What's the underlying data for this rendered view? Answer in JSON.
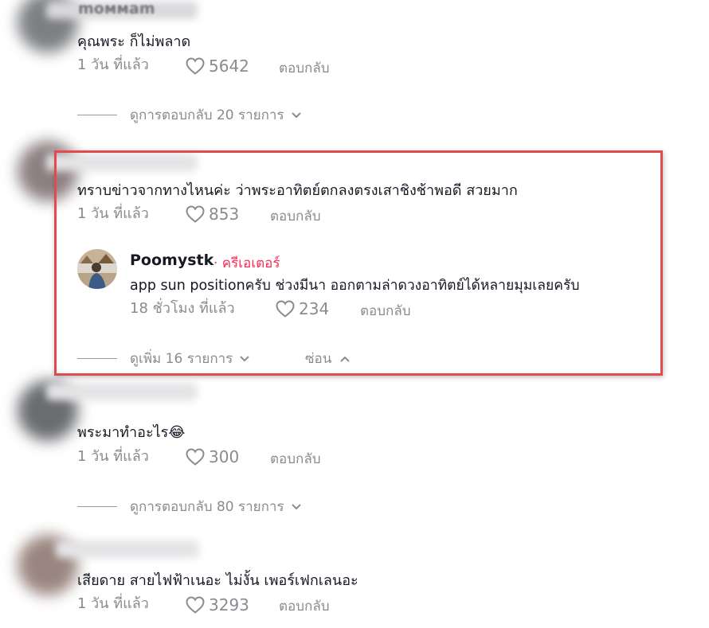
{
  "comments": [
    {
      "text": "คุณพระ ก็ไม่พลาด",
      "time": "1 วัน ที่แล้ว",
      "likes": "5642",
      "reply_label": "ตอบกลับ",
      "view_replies": "ดูการตอบกลับ 20 รายการ",
      "username_partial": "moммam"
    },
    {
      "text": "ทราบข่าวจากทางไหนค่ะ ว่าพระอาทิตย์ตกลงตรงเสาชิงช้าพอดี สวยมาก",
      "time": "1 วัน ที่แล้ว",
      "likes": "853",
      "reply_label": "ตอบกลับ",
      "reply": {
        "username": "Poomystk",
        "tag": "· ครีเอเตอร์",
        "text": "app sun positionครับ ช่วงมีนา ออกตามล่าดวงอาทิตย์ได้หลายมุมเลยครับ",
        "time": "18 ชั่วโมง ที่แล้ว",
        "likes": "234",
        "reply_label": "ตอบกลับ"
      },
      "view_more": "ดูเพิ่ม 16 รายการ",
      "hide_label": "ซ่อน"
    },
    {
      "text": "พระมาทำอะไร😂",
      "time": "1 วัน ที่แล้ว",
      "likes": "300",
      "reply_label": "ตอบกลับ",
      "view_replies": "ดูการตอบกลับ 80 รายการ"
    },
    {
      "text": "เสียดาย สายไฟฟ้าเนอะ ไม่งั้น เพอร์เฟกเลนอะ",
      "time": "1 วัน ที่แล้ว",
      "likes": "3293",
      "reply_label": "ตอบกลับ"
    }
  ],
  "colors": {
    "accent_red": "#e5484d",
    "creator_pink": "#fe2c55",
    "meta_gray": "#8a8b91"
  }
}
